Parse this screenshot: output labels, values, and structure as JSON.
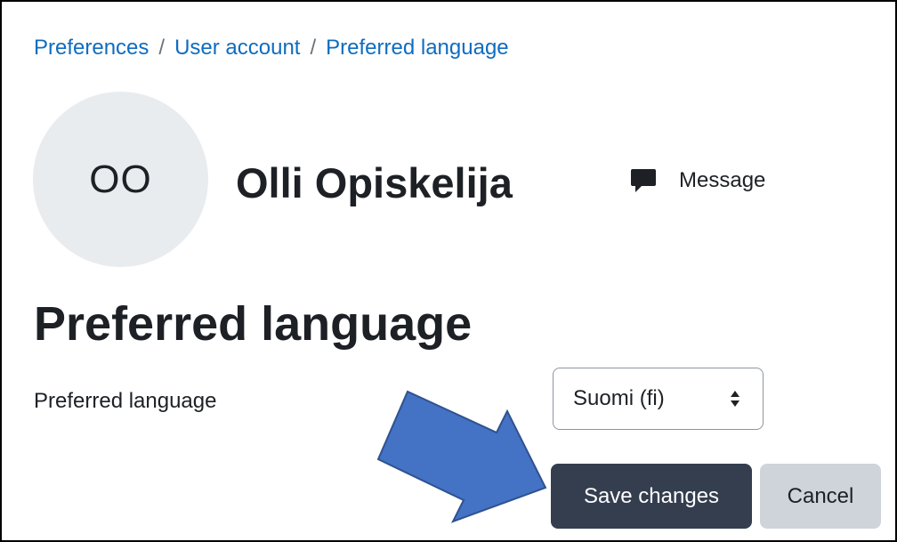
{
  "breadcrumb": {
    "items": [
      "Preferences",
      "User account",
      "Preferred language"
    ],
    "separator": "/"
  },
  "profile": {
    "initials": "OO",
    "name": "Olli Opiskelija",
    "message_label": "Message",
    "message_icon": "chat-bubble-icon"
  },
  "page": {
    "heading": "Preferred language"
  },
  "form": {
    "language_label": "Preferred language",
    "language_value": "Suomi (fi)",
    "save_label": "Save changes",
    "cancel_label": "Cancel"
  },
  "colors": {
    "link": "#0f6cbf",
    "primary_button": "#343e4f",
    "secondary_button": "#ced4da",
    "avatar_bg": "#e9ecef",
    "annotation_arrow_fill": "#4472c4",
    "annotation_arrow_stroke": "#2f528f"
  }
}
